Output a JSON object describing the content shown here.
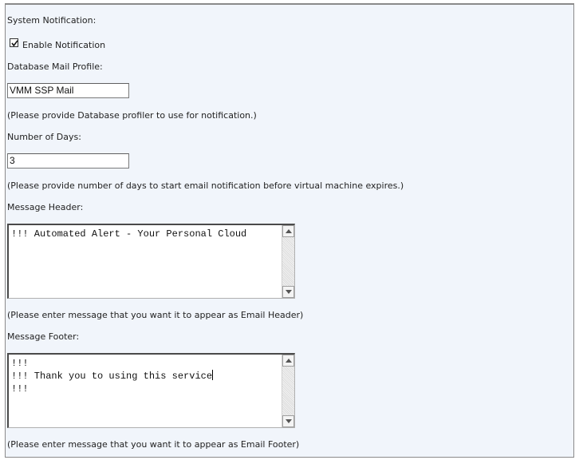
{
  "system_notification": {
    "section_label": "System Notification:",
    "enable_checkbox_label": "Enable Notification",
    "enable_checked": true
  },
  "database_mail_profile": {
    "label": "Database Mail Profile:",
    "value": "VMM SSP Mail",
    "hint": "(Please provide Database profiler to use for notification.)"
  },
  "number_of_days": {
    "label": "Number of Days:",
    "value": "3",
    "hint": "(Please provide number of days to start email notification before virtual machine expires.)"
  },
  "message_header": {
    "label": "Message Header:",
    "value": "!!! Automated Alert - Your Personal Cloud",
    "hint": "(Please enter message that you want it to appear as Email Header)"
  },
  "message_footer": {
    "label": "Message Footer:",
    "lines": [
      "!!!",
      "!!! Thank you to using this service",
      "!!!"
    ],
    "hint": "(Please enter message that you want it to appear as Email Footer)"
  },
  "icons": {
    "checkmark": "check-icon",
    "scroll_up": "arrow-up-icon",
    "scroll_down": "arrow-down-icon"
  }
}
